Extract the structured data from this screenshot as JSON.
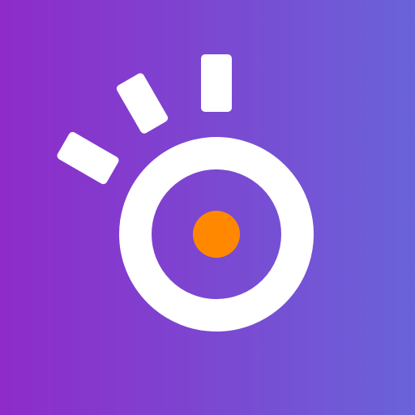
{
  "app_icon": {
    "name": "camera-ray-logo",
    "colors": {
      "gradient_start": "#8E2BC9",
      "gradient_end": "#6A63D9",
      "ring": "#FFFFFF",
      "ray": "#FFFFFF",
      "dot": "#FF8800"
    }
  }
}
